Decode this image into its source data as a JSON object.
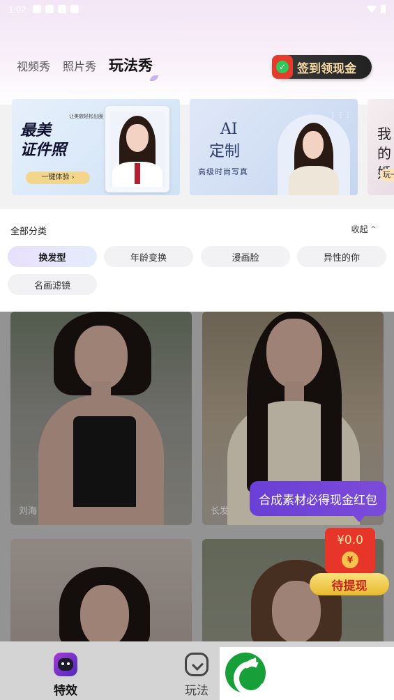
{
  "status_bar": {
    "time": "1:02"
  },
  "tabs": [
    {
      "label": "视频秀",
      "active": false
    },
    {
      "label": "照片秀",
      "active": false
    },
    {
      "label": "玩法秀",
      "active": true
    }
  ],
  "checkin": {
    "label": "签到领现金"
  },
  "banners": [
    {
      "title_line1": "最美",
      "title_line2": "证件照",
      "subtitle": "让美貌轻松出圈",
      "button": "一键体验 ›"
    },
    {
      "title_line1": "AI",
      "title_line2": "定制",
      "subtitle": "高级时尚写真"
    },
    {
      "title_line1": "我的",
      "title_line2": "婚",
      "button": "玩一"
    }
  ],
  "categories": {
    "header": "全部分类",
    "collapse_label": "收起",
    "chips": [
      {
        "label": "换发型",
        "active": true
      },
      {
        "label": "年龄变换",
        "active": false
      },
      {
        "label": "漫画脸",
        "active": false
      },
      {
        "label": "异性的你",
        "active": false
      },
      {
        "label": "名画滤镜",
        "active": false
      }
    ]
  },
  "grid": {
    "items": [
      {
        "label": "刘海"
      },
      {
        "label": "长发"
      },
      {
        "label": ""
      },
      {
        "label": ""
      }
    ]
  },
  "promo": {
    "bubble_text": "合成素材必得现金红包",
    "amount": "¥0.0",
    "coin_symbol": "¥",
    "withdraw_label": "待提现"
  },
  "bottom_nav": [
    {
      "label": "特效",
      "icon": "effects-icon",
      "active": true
    },
    {
      "label": "玩法",
      "icon": "play-icon",
      "active": false
    }
  ],
  "colors": {
    "accent_purple": "#6a3fd6",
    "red_packet": "#e8352a",
    "gold": "#f6d9a3"
  }
}
